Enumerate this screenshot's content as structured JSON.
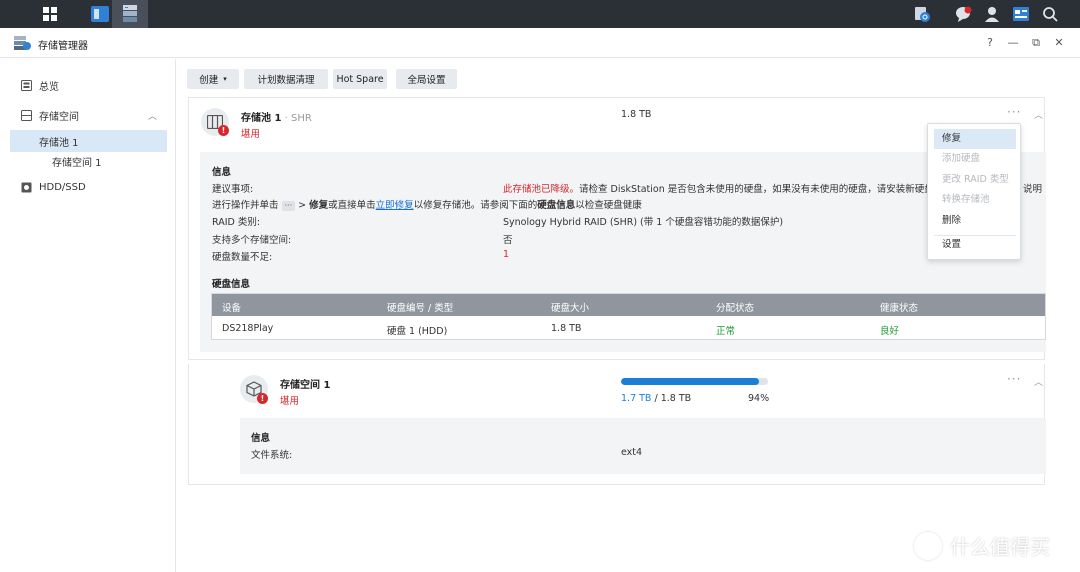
{
  "app": {
    "title": "存储管理器"
  },
  "window_controls": {
    "help": "?",
    "minimize": "—",
    "restore": "⧉",
    "close": "✕"
  },
  "sidebar": {
    "items": [
      {
        "label": "总览"
      },
      {
        "label": "存储空间"
      },
      {
        "label": "存储池 1"
      },
      {
        "label": "存储空间 1"
      },
      {
        "label": "HDD/SSD"
      }
    ]
  },
  "toolbar": {
    "create_label": "创建",
    "schedule_label": "计划数据清理",
    "hotspare_label": "Hot Spare",
    "global_label": "全局设置"
  },
  "pool": {
    "name": "存储池 1",
    "sep": " · ",
    "type": "SHR",
    "status": "堪用",
    "size": "1.8 TB",
    "info_title": "信息",
    "advice_label": "建议事项:",
    "advice_red": "此存储池已降级。",
    "advice_line1_rest": "请检查 DiskStation 是否包含未使用的硬盘，如果没有未使用的硬盘，请安装新硬盘",
    "advice_line1_tail": "说明",
    "advice_line2_a": "进行操作并单击",
    "advice_line2_ellipsis": "···",
    "advice_line2_b": "> ",
    "advice_line2_repair": "修复",
    "advice_line2_c": "或直接单击",
    "advice_line2_link": "立即修复",
    "advice_line2_d": "以修复存储池。请参阅下面的",
    "advice_line2_diskinfo": "硬盘信息",
    "advice_line2_e": "以检查硬盘健康",
    "raid_label": "RAID 类别:",
    "raid_value": "Synology Hybrid RAID (SHR) (带 1 个硬盘容错功能的数据保护)",
    "multi_label": "支持多个存储空间:",
    "multi_value": "否",
    "insufficient_label": "硬盘数量不足:",
    "insufficient_value": "1",
    "disk_info_title": "硬盘信息",
    "table": {
      "headers": [
        "设备",
        "硬盘编号 / 类型",
        "硬盘大小",
        "分配状态",
        "健康状态"
      ],
      "rows": [
        {
          "device": "DS218Play",
          "disk": "硬盘 1 (HDD)",
          "size": "1.8 TB",
          "alloc": "正常",
          "health": "良好"
        }
      ]
    }
  },
  "volume": {
    "name": "存储空间 1",
    "status": "堪用",
    "used": "1.7 TB",
    "total_sep": " / ",
    "total": "1.8 TB",
    "percent": "94%",
    "usage_fraction": 0.94,
    "info_title": "信息",
    "fs_label": "文件系统:",
    "fs_value": "ext4"
  },
  "context_menu": {
    "items": [
      {
        "label": "修复",
        "state": "highlighted"
      },
      {
        "label": "添加硬盘",
        "state": "disabled"
      },
      {
        "label": "更改 RAID 类型",
        "state": "disabled"
      },
      {
        "label": "转换存储池",
        "state": "disabled"
      },
      {
        "label": "删除",
        "state": "enabled"
      },
      {
        "label": "设置",
        "state": "enabled"
      }
    ]
  },
  "watermark": {
    "text": "什么值得买"
  },
  "colors": {
    "accent": "#1c7fd6",
    "error": "#d9262c",
    "ok": "#1a9a2c",
    "selected": "#d9e8f7"
  },
  "icons": [
    "apps-grid-icon",
    "window-app-icon",
    "storage-manager-icon",
    "notification-search-icon",
    "chat-icon",
    "user-icon",
    "widgets-icon",
    "search-icon",
    "storage-pool-icon",
    "volume-cube-icon",
    "hdd-icon"
  ]
}
